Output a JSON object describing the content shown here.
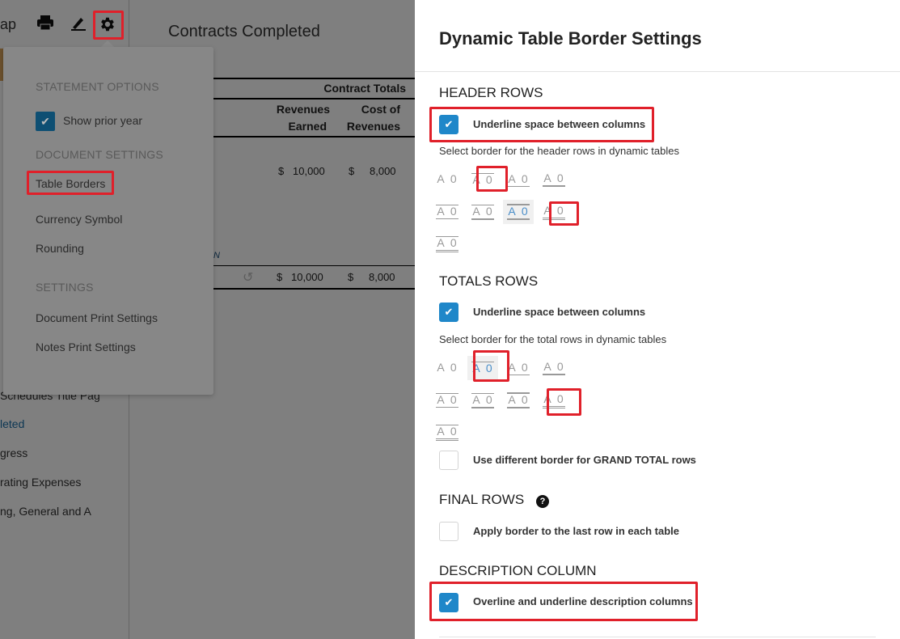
{
  "sidebar": {
    "top_text": "ap",
    "items": [
      {
        "label": "Schedules Title Pag",
        "active": false
      },
      {
        "label": "leted",
        "active": true
      },
      {
        "label": "gress",
        "active": false
      },
      {
        "label": "rating Expenses",
        "active": false
      },
      {
        "label": "ng, General and A",
        "active": false
      }
    ]
  },
  "toolbar": {
    "icons": [
      "print-icon",
      "edit-pen-icon",
      "gear-icon"
    ]
  },
  "document": {
    "title": "Contracts Completed",
    "group_header": "Contract Totals",
    "columns": [
      {
        "line1": "Revenues",
        "line2": "Earned"
      },
      {
        "line1": "Cost of",
        "line2": "Revenues"
      }
    ],
    "rows": [
      {
        "cur1": "$",
        "val1": "10,000",
        "cur2": "$",
        "val2": "8,000"
      }
    ],
    "link_fragment": "N",
    "total": {
      "cur1": "$",
      "val1": "10,000",
      "cur2": "$",
      "val2": "8,000"
    }
  },
  "menu": {
    "statement_options": "STATEMENT OPTIONS",
    "show_prior_year": "Show prior year",
    "show_prior_year_checked": true,
    "document_settings": "DOCUMENT SETTINGS",
    "table_borders": "Table Borders",
    "currency_symbol": "Currency Symbol",
    "rounding": "Rounding",
    "settings": "SETTINGS",
    "document_print_settings": "Document Print Settings",
    "notes_print_settings": "Notes Print Settings"
  },
  "panel": {
    "title": "Dynamic Table Border Settings",
    "header_rows": {
      "heading": "HEADER ROWS",
      "underline_label": "Underline space between columns",
      "underline_checked": true,
      "select_label": "Select border for the header rows in dynamic tables",
      "selected_index": 6
    },
    "totals_rows": {
      "heading": "TOTALS ROWS",
      "underline_label": "Underline space between columns",
      "underline_checked": true,
      "select_label": "Select border for the total rows in dynamic tables",
      "selected_index": 1,
      "grand_total_label": "Use different border for GRAND TOTAL rows",
      "grand_total_checked": false
    },
    "final_rows": {
      "heading": "FINAL ROWS",
      "help_icon": "?",
      "apply_label": "Apply border to the last row in each table",
      "apply_checked": false
    },
    "description_column": {
      "heading": "DESCRIPTION COLUMN",
      "label": "Overline and underline description columns",
      "checked": true
    },
    "border_option_text": "A 0",
    "border_styles": [
      "none",
      "top-thin",
      "bottom-thin",
      "bottom-thick",
      "top-thin bottom-thin",
      "top-thin bottom-thick",
      "top-thick bottom-thick",
      "bottom-double",
      "top-thin bottom-double"
    ]
  },
  "colors": {
    "accent": "#1f87c9",
    "highlight": "#e0202a",
    "selected_text": "#4a8ec9"
  }
}
